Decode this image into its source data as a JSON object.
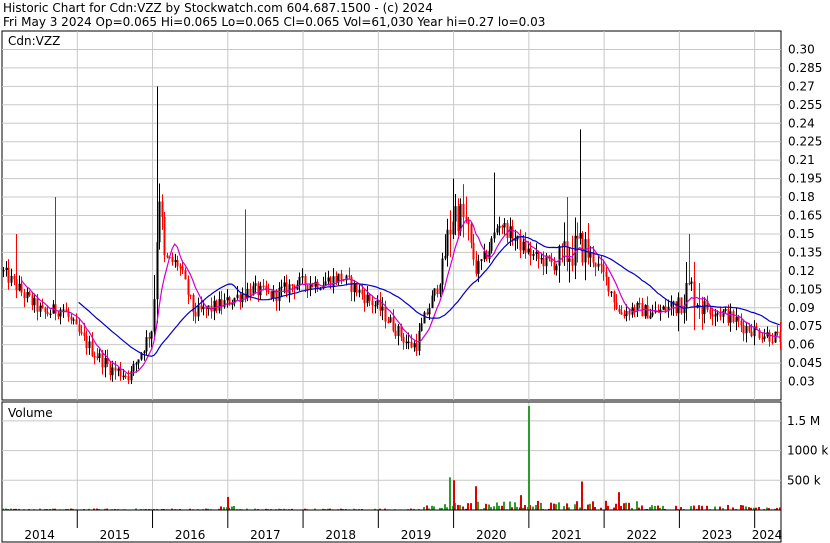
{
  "header": {
    "line1": "Historic Chart for Cdn:VZZ by Stockwatch.com 604.687.1500 - (c) 2024",
    "line2": "Fri May  3 2024  Op=0.065  Hi=0.065  Lo=0.065  Cl=0.065  Vol=61,030  Year hi=0.27  lo=0.03"
  },
  "chart_data": [
    {
      "type": "candlestick",
      "title": "Cdn:VZZ",
      "ylim": [
        0.015,
        0.315
      ],
      "y_ticks": [
        "0.30",
        "0.285",
        "0.27",
        "0.255",
        "0.24",
        "0.225",
        "0.21",
        "0.195",
        "0.18",
        "0.165",
        "0.15",
        "0.135",
        "0.12",
        "0.105",
        "0.09",
        "0.075",
        "0.06",
        "0.045",
        "0.03"
      ],
      "x_ticks": [
        "2014",
        "2015",
        "2016",
        "2017",
        "2018",
        "2019",
        "2020",
        "2021",
        "2022",
        "2023",
        "2024"
      ],
      "x_range": [
        2014.0,
        2024.35
      ],
      "grid": true,
      "colors": {
        "up": "#000000",
        "down": "#ff0000",
        "ma_short": "#d000d0",
        "ma_long": "#0000cc",
        "grid": "#c8c8c8"
      },
      "price_anchors": [
        [
          2014.0,
          0.12
        ],
        [
          2014.3,
          0.1
        ],
        [
          2014.55,
          0.085
        ],
        [
          2014.8,
          0.09
        ],
        [
          2015.0,
          0.07
        ],
        [
          2015.2,
          0.055
        ],
        [
          2015.45,
          0.04
        ],
        [
          2015.7,
          0.035
        ],
        [
          2016.0,
          0.075
        ],
        [
          2016.08,
          0.19
        ],
        [
          2016.15,
          0.13
        ],
        [
          2016.35,
          0.125
        ],
        [
          2016.55,
          0.085
        ],
        [
          2016.8,
          0.09
        ],
        [
          2017.0,
          0.095
        ],
        [
          2017.3,
          0.105
        ],
        [
          2017.6,
          0.1
        ],
        [
          2017.9,
          0.11
        ],
        [
          2018.2,
          0.11
        ],
        [
          2018.5,
          0.115
        ],
        [
          2018.8,
          0.1
        ],
        [
          2019.0,
          0.09
        ],
        [
          2019.2,
          0.075
        ],
        [
          2019.4,
          0.06
        ],
        [
          2019.5,
          0.06
        ],
        [
          2019.6,
          0.08
        ],
        [
          2019.8,
          0.11
        ],
        [
          2020.0,
          0.17
        ],
        [
          2020.15,
          0.16
        ],
        [
          2020.3,
          0.12
        ],
        [
          2020.45,
          0.135
        ],
        [
          2020.6,
          0.16
        ],
        [
          2020.75,
          0.15
        ],
        [
          2020.9,
          0.14
        ],
        [
          2021.1,
          0.13
        ],
        [
          2021.35,
          0.125
        ],
        [
          2021.55,
          0.135
        ],
        [
          2021.7,
          0.14
        ],
        [
          2021.85,
          0.13
        ],
        [
          2022.05,
          0.11
        ],
        [
          2022.2,
          0.085
        ],
        [
          2022.4,
          0.09
        ],
        [
          2022.65,
          0.085
        ],
        [
          2022.85,
          0.09
        ],
        [
          2023.0,
          0.1
        ],
        [
          2023.15,
          0.105
        ],
        [
          2023.35,
          0.09
        ],
        [
          2023.6,
          0.085
        ],
        [
          2023.85,
          0.075
        ],
        [
          2024.05,
          0.07
        ],
        [
          2024.34,
          0.065
        ]
      ],
      "spikes": [
        [
          2014.2,
          0.15
        ],
        [
          2014.72,
          0.18
        ],
        [
          2016.05,
          0.27
        ],
        [
          2017.23,
          0.17
        ],
        [
          2019.98,
          0.195
        ],
        [
          2020.55,
          0.2
        ],
        [
          2021.5,
          0.18
        ],
        [
          2021.68,
          0.235
        ],
        [
          2023.12,
          0.15
        ]
      ],
      "series": [
        {
          "name": "price",
          "kind": "candles"
        },
        {
          "name": "moving average (short)",
          "kind": "line"
        },
        {
          "name": "moving average (long)",
          "kind": "line"
        }
      ]
    },
    {
      "type": "bar",
      "title": "Volume",
      "y_ticks": [
        "1.5 M",
        "1000 k",
        "500 k"
      ],
      "ylim": [
        0,
        1750000
      ],
      "peaks": [
        [
          2021.0,
          1750000
        ],
        [
          2019.95,
          550000
        ],
        [
          2020.0,
          500000
        ],
        [
          2021.7,
          480000
        ],
        [
          2020.3,
          400000
        ],
        [
          2022.2,
          300000
        ],
        [
          2020.9,
          250000
        ],
        [
          2017.0,
          220000
        ]
      ]
    }
  ]
}
